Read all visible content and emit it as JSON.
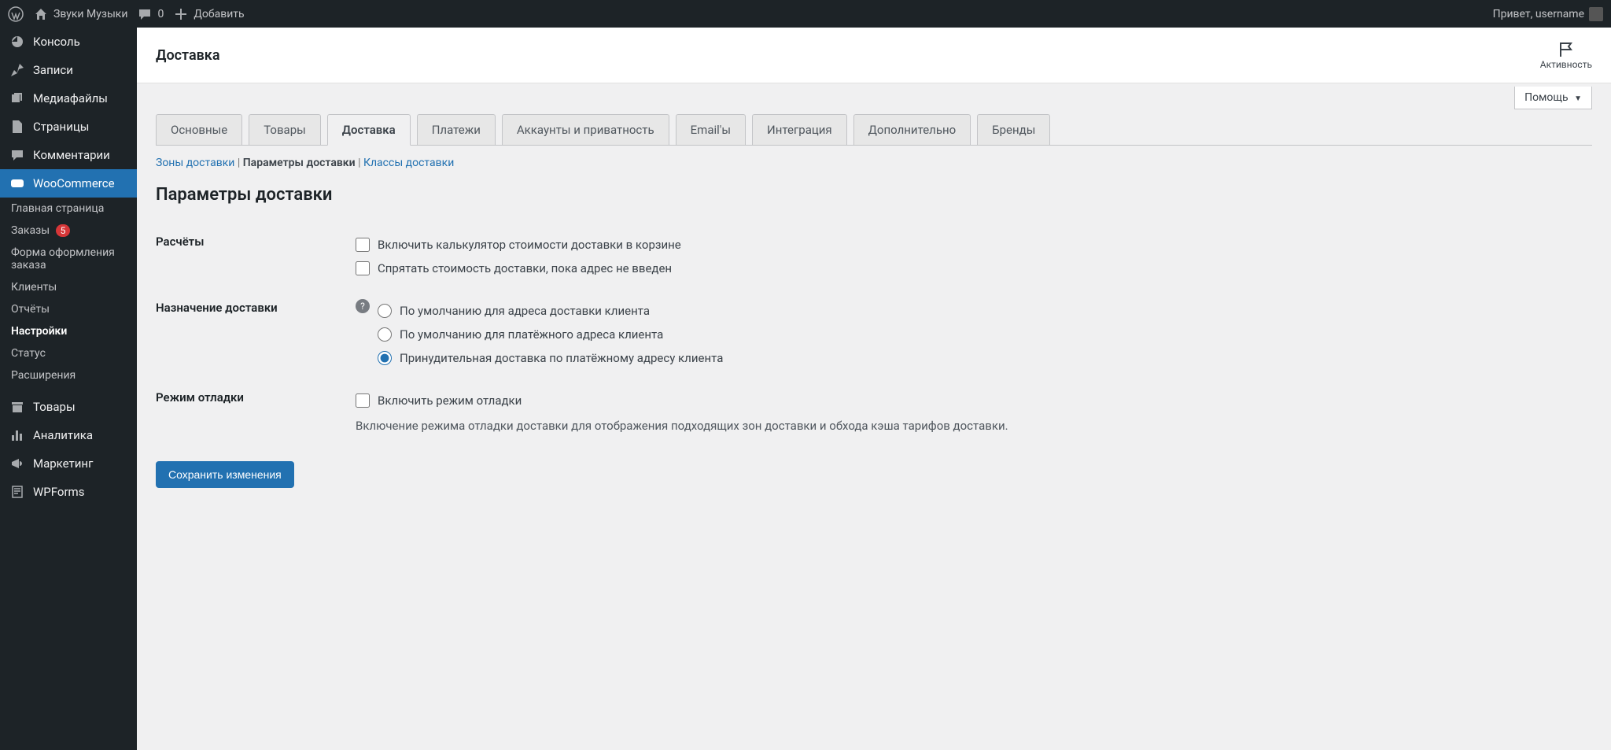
{
  "adminbar": {
    "site_name": "Звуки Музыки",
    "comments_count": "0",
    "add_label": "Добавить",
    "greeting": "Привет, username"
  },
  "sidebar": {
    "items": [
      {
        "id": "dashboard",
        "label": "Консоль"
      },
      {
        "id": "posts",
        "label": "Записи"
      },
      {
        "id": "media",
        "label": "Медиафайлы"
      },
      {
        "id": "pages",
        "label": "Страницы"
      },
      {
        "id": "comments",
        "label": "Комментарии"
      },
      {
        "id": "woocommerce",
        "label": "WooCommerce",
        "active": true
      },
      {
        "id": "products",
        "label": "Товары"
      },
      {
        "id": "analytics",
        "label": "Аналитика"
      },
      {
        "id": "marketing",
        "label": "Маркетинг"
      },
      {
        "id": "wpforms",
        "label": "WPForms"
      }
    ],
    "submenu": [
      {
        "label": "Главная страница"
      },
      {
        "label": "Заказы",
        "badge": "5"
      },
      {
        "label": "Форма оформления заказа"
      },
      {
        "label": "Клиенты"
      },
      {
        "label": "Отчёты"
      },
      {
        "label": "Настройки",
        "active": true
      },
      {
        "label": "Статус"
      },
      {
        "label": "Расширения"
      }
    ]
  },
  "header": {
    "page_title": "Доставка",
    "activity_label": "Активность",
    "help_label": "Помощь"
  },
  "tabs": [
    {
      "label": "Основные"
    },
    {
      "label": "Товары"
    },
    {
      "label": "Доставка",
      "active": true
    },
    {
      "label": "Платежи"
    },
    {
      "label": "Аккаунты и приватность"
    },
    {
      "label": "Email'ы"
    },
    {
      "label": "Интеграция"
    },
    {
      "label": "Дополнительно"
    },
    {
      "label": "Бренды"
    }
  ],
  "subnav": {
    "zones": "Зоны доставки",
    "params": "Параметры доставки",
    "classes": "Классы доставки"
  },
  "section_title": "Параметры доставки",
  "form": {
    "calculations_label": "Расчёты",
    "calc_opt1": "Включить калькулятор стоимости доставки в корзине",
    "calc_opt2": "Спрятать стоимость доставки, пока адрес не введен",
    "dest_label": "Назначение доставки",
    "dest_opt1": "По умолчанию для адреса доставки клиента",
    "dest_opt2": "По умолчанию для платёжного адреса клиента",
    "dest_opt3": "Принудительная доставка по платёжному адресу клиента",
    "debug_label": "Режим отладки",
    "debug_opt": "Включить режим отладки",
    "debug_desc": "Включение режима отладки доставки для отображения подходящих зон доставки и обхода кэша тарифов доставки."
  },
  "save_button": "Сохранить изменения"
}
